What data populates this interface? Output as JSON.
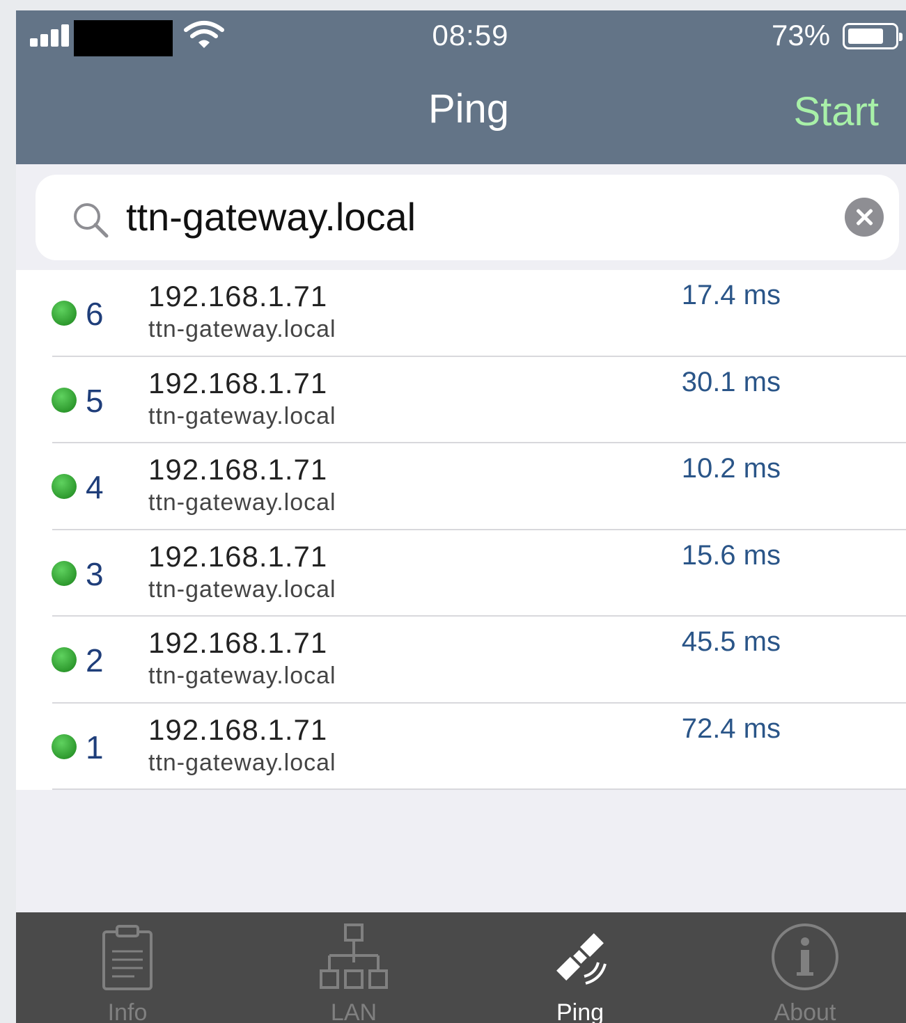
{
  "status_bar": {
    "time": "08:59",
    "battery_percent": "73%",
    "battery_level": 0.73
  },
  "nav": {
    "title": "Ping",
    "action_label": "Start"
  },
  "search": {
    "value": "ttn-gateway.local",
    "placeholder": ""
  },
  "results": [
    {
      "seq": "6",
      "ip": "192.168.1.71",
      "host": "ttn-gateway.local",
      "time": "17.4 ms"
    },
    {
      "seq": "5",
      "ip": "192.168.1.71",
      "host": "ttn-gateway.local",
      "time": "30.1 ms"
    },
    {
      "seq": "4",
      "ip": "192.168.1.71",
      "host": "ttn-gateway.local",
      "time": "10.2 ms"
    },
    {
      "seq": "3",
      "ip": "192.168.1.71",
      "host": "ttn-gateway.local",
      "time": "15.6 ms"
    },
    {
      "seq": "2",
      "ip": "192.168.1.71",
      "host": "ttn-gateway.local",
      "time": "45.5 ms"
    },
    {
      "seq": "1",
      "ip": "192.168.1.71",
      "host": "ttn-gateway.local",
      "time": "72.4 ms"
    }
  ],
  "tabs": [
    {
      "label": "Info",
      "icon": "clipboard-icon",
      "active": false
    },
    {
      "label": "LAN",
      "icon": "network-icon",
      "active": false
    },
    {
      "label": "Ping",
      "icon": "satellite-icon",
      "active": true
    },
    {
      "label": "About",
      "icon": "info-circle-icon",
      "active": false
    }
  ],
  "colors": {
    "nav_bar": "#637487",
    "start_action": "#a8f0a8",
    "status_ok": "#2e9a2e",
    "tab_bar": "#4a4a4a"
  }
}
